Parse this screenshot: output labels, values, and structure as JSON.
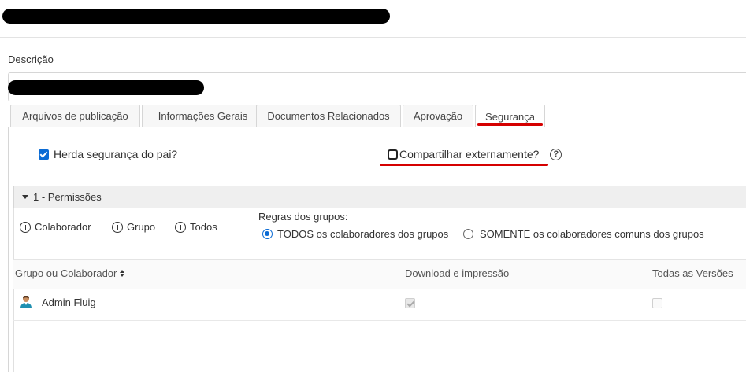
{
  "description": {
    "label": "Descrição"
  },
  "tabs": [
    {
      "label": "Arquivos de publicação"
    },
    {
      "label": "Informações Gerais"
    },
    {
      "label": "Documentos Relacionados"
    },
    {
      "label": "Aprovação"
    },
    {
      "label": "Segurança",
      "active": true
    }
  ],
  "security": {
    "inherit_label": "Herda segurança do pai?",
    "inherit_checked": true,
    "share_label": "Compartilhar externamente?",
    "share_checked": false,
    "help_glyph": "?"
  },
  "permissions": {
    "header": "1 - Permissões",
    "add_buttons": [
      {
        "label": "Colaborador",
        "icon": "plus-circle-icon"
      },
      {
        "label": "Grupo",
        "icon": "plus-circle-icon"
      },
      {
        "label": "Todos",
        "icon": "plus-circle-icon"
      }
    ],
    "rules_label": "Regras dos grupos:",
    "rules_options": [
      {
        "label": "TODOS os colaboradores dos grupos",
        "selected": true
      },
      {
        "label": "SOMENTE os colaboradores comuns dos grupos",
        "selected": false
      }
    ],
    "columns": [
      "Grupo ou Colaborador",
      "Download e impressão",
      "Todas as Versões"
    ],
    "rows": [
      {
        "name": "Admin Fluig",
        "download": true,
        "all_versions": false,
        "icon": "user-icon"
      }
    ]
  },
  "colors": {
    "accent": "#0b6bd4",
    "highlight": "#d50000"
  }
}
